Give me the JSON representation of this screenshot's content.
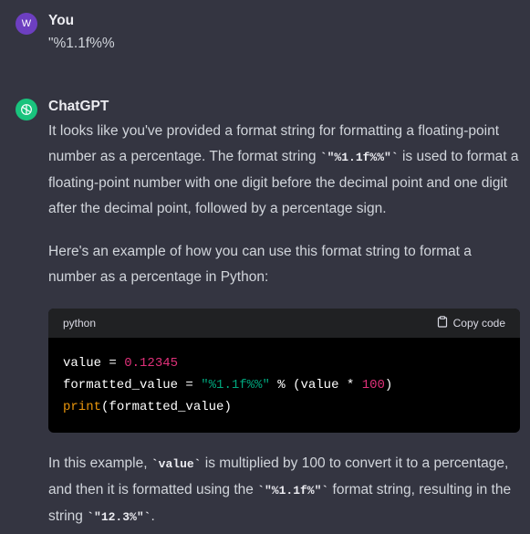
{
  "user": {
    "avatar_letter": "W",
    "name": "You",
    "message": "\"%1.1f%%"
  },
  "assistant": {
    "name": "ChatGPT",
    "p1_a": "It looks like you've provided a format string for formatting a floating-point number as a percentage. The format string ",
    "p1_code": "`\"%1.1f%%\"`",
    "p1_b": " is used to format a floating-point number with one digit before the decimal point and one digit after the decimal point, followed by a percentage sign.",
    "p2": "Here's an example of how you can use this format string to format a number as a percentage in Python:",
    "code": {
      "language": "python",
      "copy_label": "Copy code",
      "line1_var": "value = ",
      "line1_num": "0.12345",
      "line2_var": "formatted_value = ",
      "line2_str": "\"%1.1f%%\"",
      "line2_mid": " % (value * ",
      "line2_num": "100",
      "line2_end": ")",
      "line3_fn": "print",
      "line3_rest": "(formatted_value)"
    },
    "p3_a": "In this example, ",
    "p3_code1": "`value`",
    "p3_b": " is multiplied by 100 to convert it to a percentage, and then it is formatted using the ",
    "p3_code2": "`\"%1.1f%\"`",
    "p3_c": " format string, resulting in the string ",
    "p3_code3": "`\"12.3%\"`",
    "p3_d": "."
  }
}
